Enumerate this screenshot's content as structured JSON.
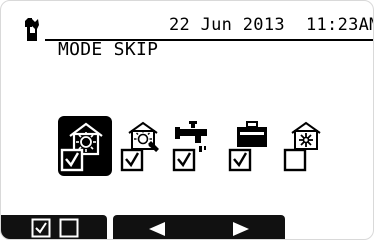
{
  "status_bar": {
    "date": "22 Jun 2013",
    "time": "11:23AM"
  },
  "screen": {
    "title": "MODE SKIP"
  },
  "modes": [
    {
      "name": "heating",
      "icon": "heating-sun-icon",
      "checked": true,
      "selected": true
    },
    {
      "name": "heating-eco",
      "icon": "heating-eco-icon",
      "checked": true,
      "selected": false
    },
    {
      "name": "hot-water",
      "icon": "hot-water-tap-icon",
      "checked": true,
      "selected": false
    },
    {
      "name": "holiday",
      "icon": "holiday-suitcase-icon",
      "checked": true,
      "selected": false
    },
    {
      "name": "cooling",
      "icon": "cooling-snowflake-icon",
      "checked": false,
      "selected": false
    }
  ],
  "function_keys": {
    "f1": {
      "icon": "checkbox-checked-icon"
    },
    "f2": {
      "icon": "checkbox-empty-icon"
    },
    "f3": {
      "icon": "arrow-left-icon"
    },
    "f4": {
      "icon": "arrow-right-icon"
    }
  },
  "colors": {
    "foreground": "#000000",
    "background": "#ffffff",
    "function_bar": "#111111"
  }
}
